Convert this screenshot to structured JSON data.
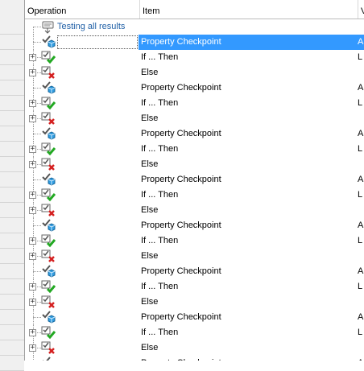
{
  "columns": {
    "operation": "Operation",
    "item": "Item",
    "third": "V"
  },
  "group_label": "Testing all results",
  "rows": [
    {
      "type": "group",
      "item": "",
      "w": ""
    },
    {
      "type": "checkpoint",
      "item": "Property Checkpoint",
      "w": "A",
      "selected": true
    },
    {
      "type": "if",
      "item": "If ... Then",
      "w": "L"
    },
    {
      "type": "else",
      "item": "Else",
      "w": ""
    },
    {
      "type": "checkpoint",
      "item": "Property Checkpoint",
      "w": "A"
    },
    {
      "type": "if",
      "item": "If ... Then",
      "w": "L"
    },
    {
      "type": "else",
      "item": "Else",
      "w": ""
    },
    {
      "type": "checkpoint",
      "item": "Property Checkpoint",
      "w": "A"
    },
    {
      "type": "if",
      "item": "If ... Then",
      "w": "L"
    },
    {
      "type": "else",
      "item": "Else",
      "w": ""
    },
    {
      "type": "checkpoint",
      "item": "Property Checkpoint",
      "w": "A"
    },
    {
      "type": "if",
      "item": "If ... Then",
      "w": "L"
    },
    {
      "type": "else",
      "item": "Else",
      "w": ""
    },
    {
      "type": "checkpoint",
      "item": "Property Checkpoint",
      "w": "A"
    },
    {
      "type": "if",
      "item": "If ... Then",
      "w": "L"
    },
    {
      "type": "else",
      "item": "Else",
      "w": ""
    },
    {
      "type": "checkpoint",
      "item": "Property Checkpoint",
      "w": "A"
    },
    {
      "type": "if",
      "item": "If ... Then",
      "w": "L"
    },
    {
      "type": "else",
      "item": "Else",
      "w": ""
    },
    {
      "type": "checkpoint",
      "item": "Property Checkpoint",
      "w": "A"
    },
    {
      "type": "if",
      "item": "If ... Then",
      "w": "L"
    },
    {
      "type": "else",
      "item": "Else",
      "w": ""
    },
    {
      "type": "checkpoint",
      "item": "Property Checkpoint",
      "w": "A"
    }
  ],
  "expander_symbol": "+",
  "icons": {
    "group": "test-group-icon",
    "checkpoint": "property-checkpoint-icon",
    "if": "if-then-icon",
    "else": "else-icon"
  },
  "colors": {
    "selection": "#3399ff",
    "group_text": "#1f5fa6",
    "check_green": "#22a822",
    "cross_red": "#d42020",
    "cube_blue": "#2e9be0"
  }
}
